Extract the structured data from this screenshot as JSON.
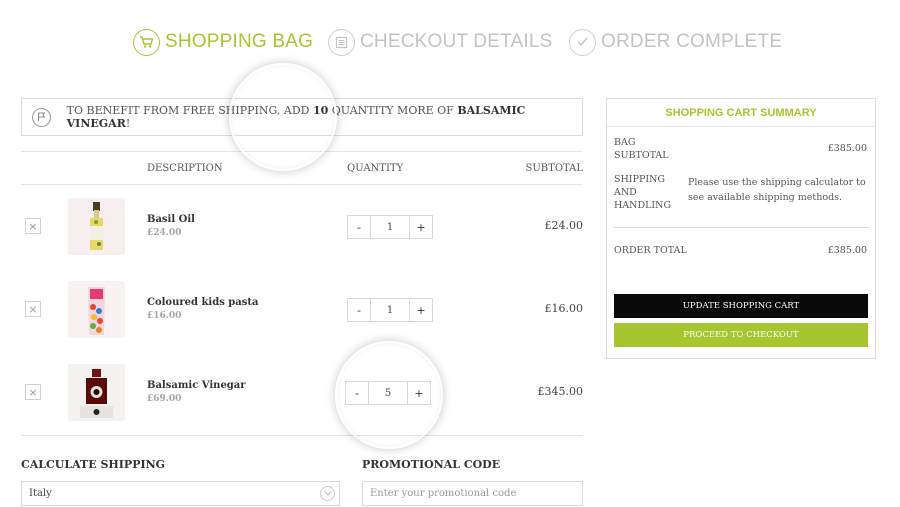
{
  "steps": [
    {
      "label": "SHOPPING BAG",
      "icon": "cart-icon",
      "active": true
    },
    {
      "label": "CHECKOUT DETAILS",
      "icon": "clipboard-icon",
      "active": false
    },
    {
      "label": "ORDER COMPLETE",
      "icon": "checkmark-icon",
      "active": false
    }
  ],
  "notice": {
    "prefix": "TO BENEFIT FROM FREE SHIPPING, ADD",
    "count": "10",
    "middle": "QUANTITY MORE OF",
    "product": "BALSAMIC VINEGAR",
    "suffix": "!"
  },
  "table": {
    "headers": {
      "description": "DESCRIPTION",
      "quantity": "QUANTITY",
      "subtotal": "SUBTOTAL"
    },
    "items": [
      {
        "name": "Basil Oil",
        "price": "£24.00",
        "qty": "1",
        "subtotal": "£24.00",
        "remove": "×",
        "minus": "-",
        "plus": "+"
      },
      {
        "name": "Coloured kids pasta",
        "price": "£16.00",
        "qty": "1",
        "subtotal": "£16.00",
        "remove": "×",
        "minus": "-",
        "plus": "+"
      },
      {
        "name": "Balsamic Vinegar",
        "price": "£69.00",
        "qty": "5",
        "subtotal": "£345.00",
        "remove": "×",
        "minus": "-",
        "plus": "+"
      }
    ]
  },
  "shipping": {
    "heading": "CALCULATE SHIPPING",
    "country": "Italy"
  },
  "promo": {
    "heading": "PROMOTIONAL CODE",
    "placeholder": "Enter your promotional code"
  },
  "summary": {
    "title": "SHOPPING CART SUMMARY",
    "bag_subtotal_label": "BAG SUBTOTAL",
    "bag_subtotal_value": "£385.00",
    "shipping_label": "SHIPPING AND HANDLING",
    "shipping_note": "Please use the shipping calculator to see available shipping methods.",
    "order_total_label": "ORDER TOTAL",
    "order_total_value": "£385.00",
    "update_button": "UPDATE SHOPPING CART",
    "checkout_button": "PROCEED TO CHECKOUT"
  },
  "colors": {
    "accent": "#a7c52e",
    "dark_button": "#0a0a0a",
    "border": "#dcdcdc"
  }
}
